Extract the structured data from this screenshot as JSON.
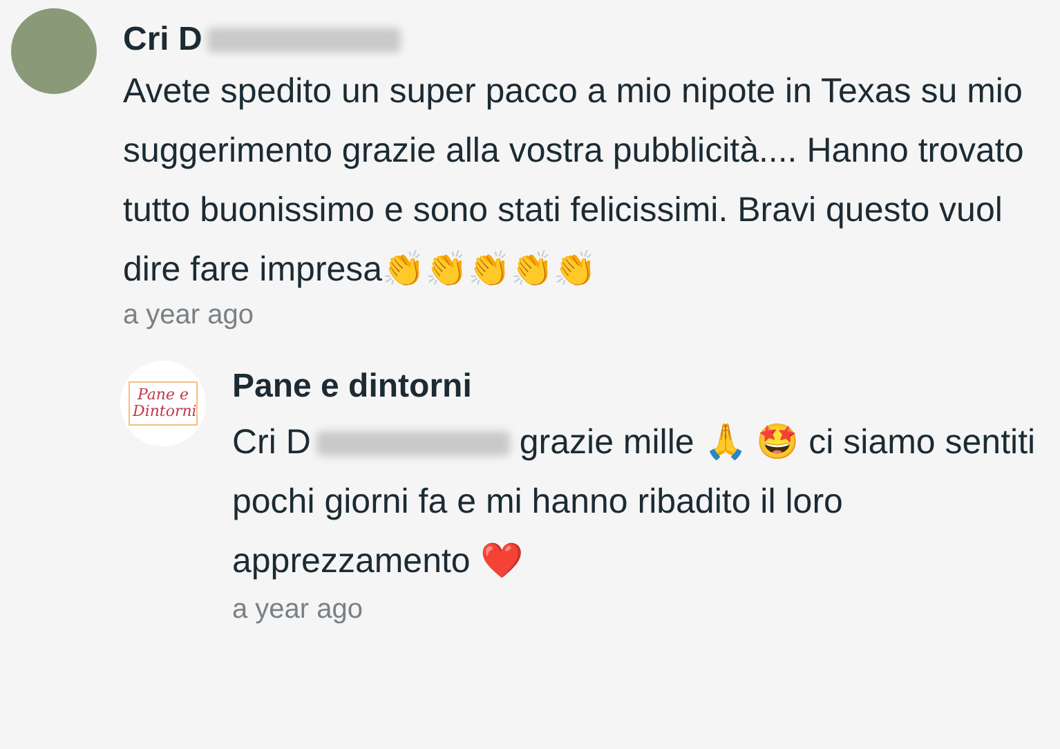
{
  "comment": {
    "author": "Cri D",
    "text": "Avete spedito un super pacco a mio nipote in Texas su mio suggerimento grazie alla vostra pubblicità.... Hanno trovato tutto buonissimo e sono stati felicissimi. Bravi questo vuol dire fare impresa👏👏👏👏👏",
    "time": "a year ago"
  },
  "reply": {
    "author": "Pane e dintorni",
    "logo_text": "Pane e Dintorni",
    "mention": "Cri D",
    "text": " grazie mille 🙏 🤩 ci siamo sentiti pochi giorni fa e mi hanno ribadito il loro apprezzamento ❤️",
    "time": "a year ago"
  }
}
